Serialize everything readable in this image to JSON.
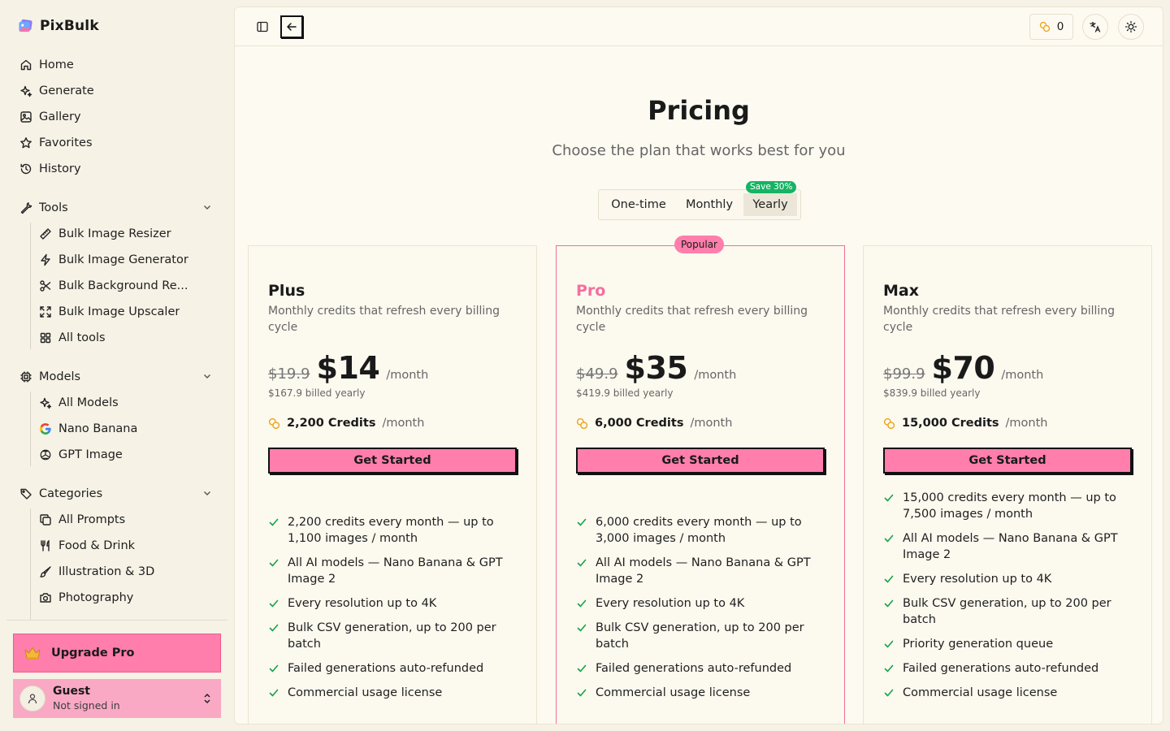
{
  "app": {
    "name": "PixBulk"
  },
  "sidebar": {
    "main_nav": [
      {
        "label": "Home",
        "icon": "home-icon"
      },
      {
        "label": "Generate",
        "icon": "sparkles-icon"
      },
      {
        "label": "Gallery",
        "icon": "image-icon"
      },
      {
        "label": "Favorites",
        "icon": "star-icon"
      },
      {
        "label": "History",
        "icon": "history-icon"
      }
    ],
    "tools": {
      "label": "Tools",
      "items": [
        {
          "label": "Bulk Image Resizer",
          "icon": "ruler-icon"
        },
        {
          "label": "Bulk Image Generator",
          "icon": "zap-icon"
        },
        {
          "label": "Bulk Background Re...",
          "icon": "scissors-icon"
        },
        {
          "label": "Bulk Image Upscaler",
          "icon": "expand-icon"
        },
        {
          "label": "All tools",
          "icon": "grid-icon"
        }
      ]
    },
    "models": {
      "label": "Models",
      "items": [
        {
          "label": "All Models",
          "icon": "sparkles-icon"
        },
        {
          "label": "Nano Banana",
          "icon": "google-icon"
        },
        {
          "label": "GPT Image",
          "icon": "openai-icon"
        }
      ]
    },
    "categories": {
      "label": "Categories",
      "items": [
        {
          "label": "All Prompts",
          "icon": "copy-icon"
        },
        {
          "label": "Food & Drink",
          "icon": "utensils-icon"
        },
        {
          "label": "Illustration & 3D",
          "icon": "brush-icon"
        },
        {
          "label": "Photography",
          "icon": "camera-icon"
        }
      ]
    },
    "upgrade_label": "Upgrade Pro",
    "user": {
      "name": "Guest",
      "status": "Not signed in"
    }
  },
  "topbar": {
    "credits": "0"
  },
  "pricing": {
    "title": "Pricing",
    "subtitle": "Choose the plan that works best for you",
    "billing_options": [
      "One-time",
      "Monthly",
      "Yearly"
    ],
    "selected_billing": "Yearly",
    "save_badge": "Save 30%",
    "popular_badge": "Popular",
    "plans": [
      {
        "name": "Plus",
        "description": "Monthly credits that refresh every billing cycle",
        "old_price": "$19.9",
        "price": "$14",
        "price_unit": "/month",
        "billed": "$167.9 billed yearly",
        "credits": "2,200 Credits",
        "credits_unit": "/month",
        "cta": "Get Started",
        "features": [
          "2,200 credits every month — up to 1,100 images / month",
          "All AI models — Nano Banana & GPT Image 2",
          "Every resolution up to 4K",
          "Bulk CSV generation, up to 200 per batch",
          "Failed generations auto-refunded",
          "Commercial usage license"
        ]
      },
      {
        "name": "Pro",
        "description": "Monthly credits that refresh every billing cycle",
        "old_price": "$49.9",
        "price": "$35",
        "price_unit": "/month",
        "billed": "$419.9 billed yearly",
        "credits": "6,000 Credits",
        "credits_unit": "/month",
        "cta": "Get Started",
        "features": [
          "6,000 credits every month — up to 3,000 images / month",
          "All AI models — Nano Banana & GPT Image 2",
          "Every resolution up to 4K",
          "Bulk CSV generation, up to 200 per batch",
          "Failed generations auto-refunded",
          "Commercial usage license"
        ]
      },
      {
        "name": "Max",
        "description": "Monthly credits that refresh every billing cycle",
        "old_price": "$99.9",
        "price": "$70",
        "price_unit": "/month",
        "billed": "$839.9 billed yearly",
        "credits": "15,000 Credits",
        "credits_unit": "/month",
        "cta": "Get Started",
        "features": [
          "15,000 credits every month — up to 7,500 images / month",
          "All AI models — Nano Banana & GPT Image 2",
          "Every resolution up to 4K",
          "Bulk CSV generation, up to 200 per batch",
          "Priority generation queue",
          "Failed generations auto-refunded",
          "Commercial usage license"
        ]
      }
    ]
  },
  "colors": {
    "accent": "#ff7eab",
    "accent_text": "#f2709f",
    "success": "#16b364",
    "background": "#f6f2e6",
    "panel": "#fdfaf1"
  }
}
